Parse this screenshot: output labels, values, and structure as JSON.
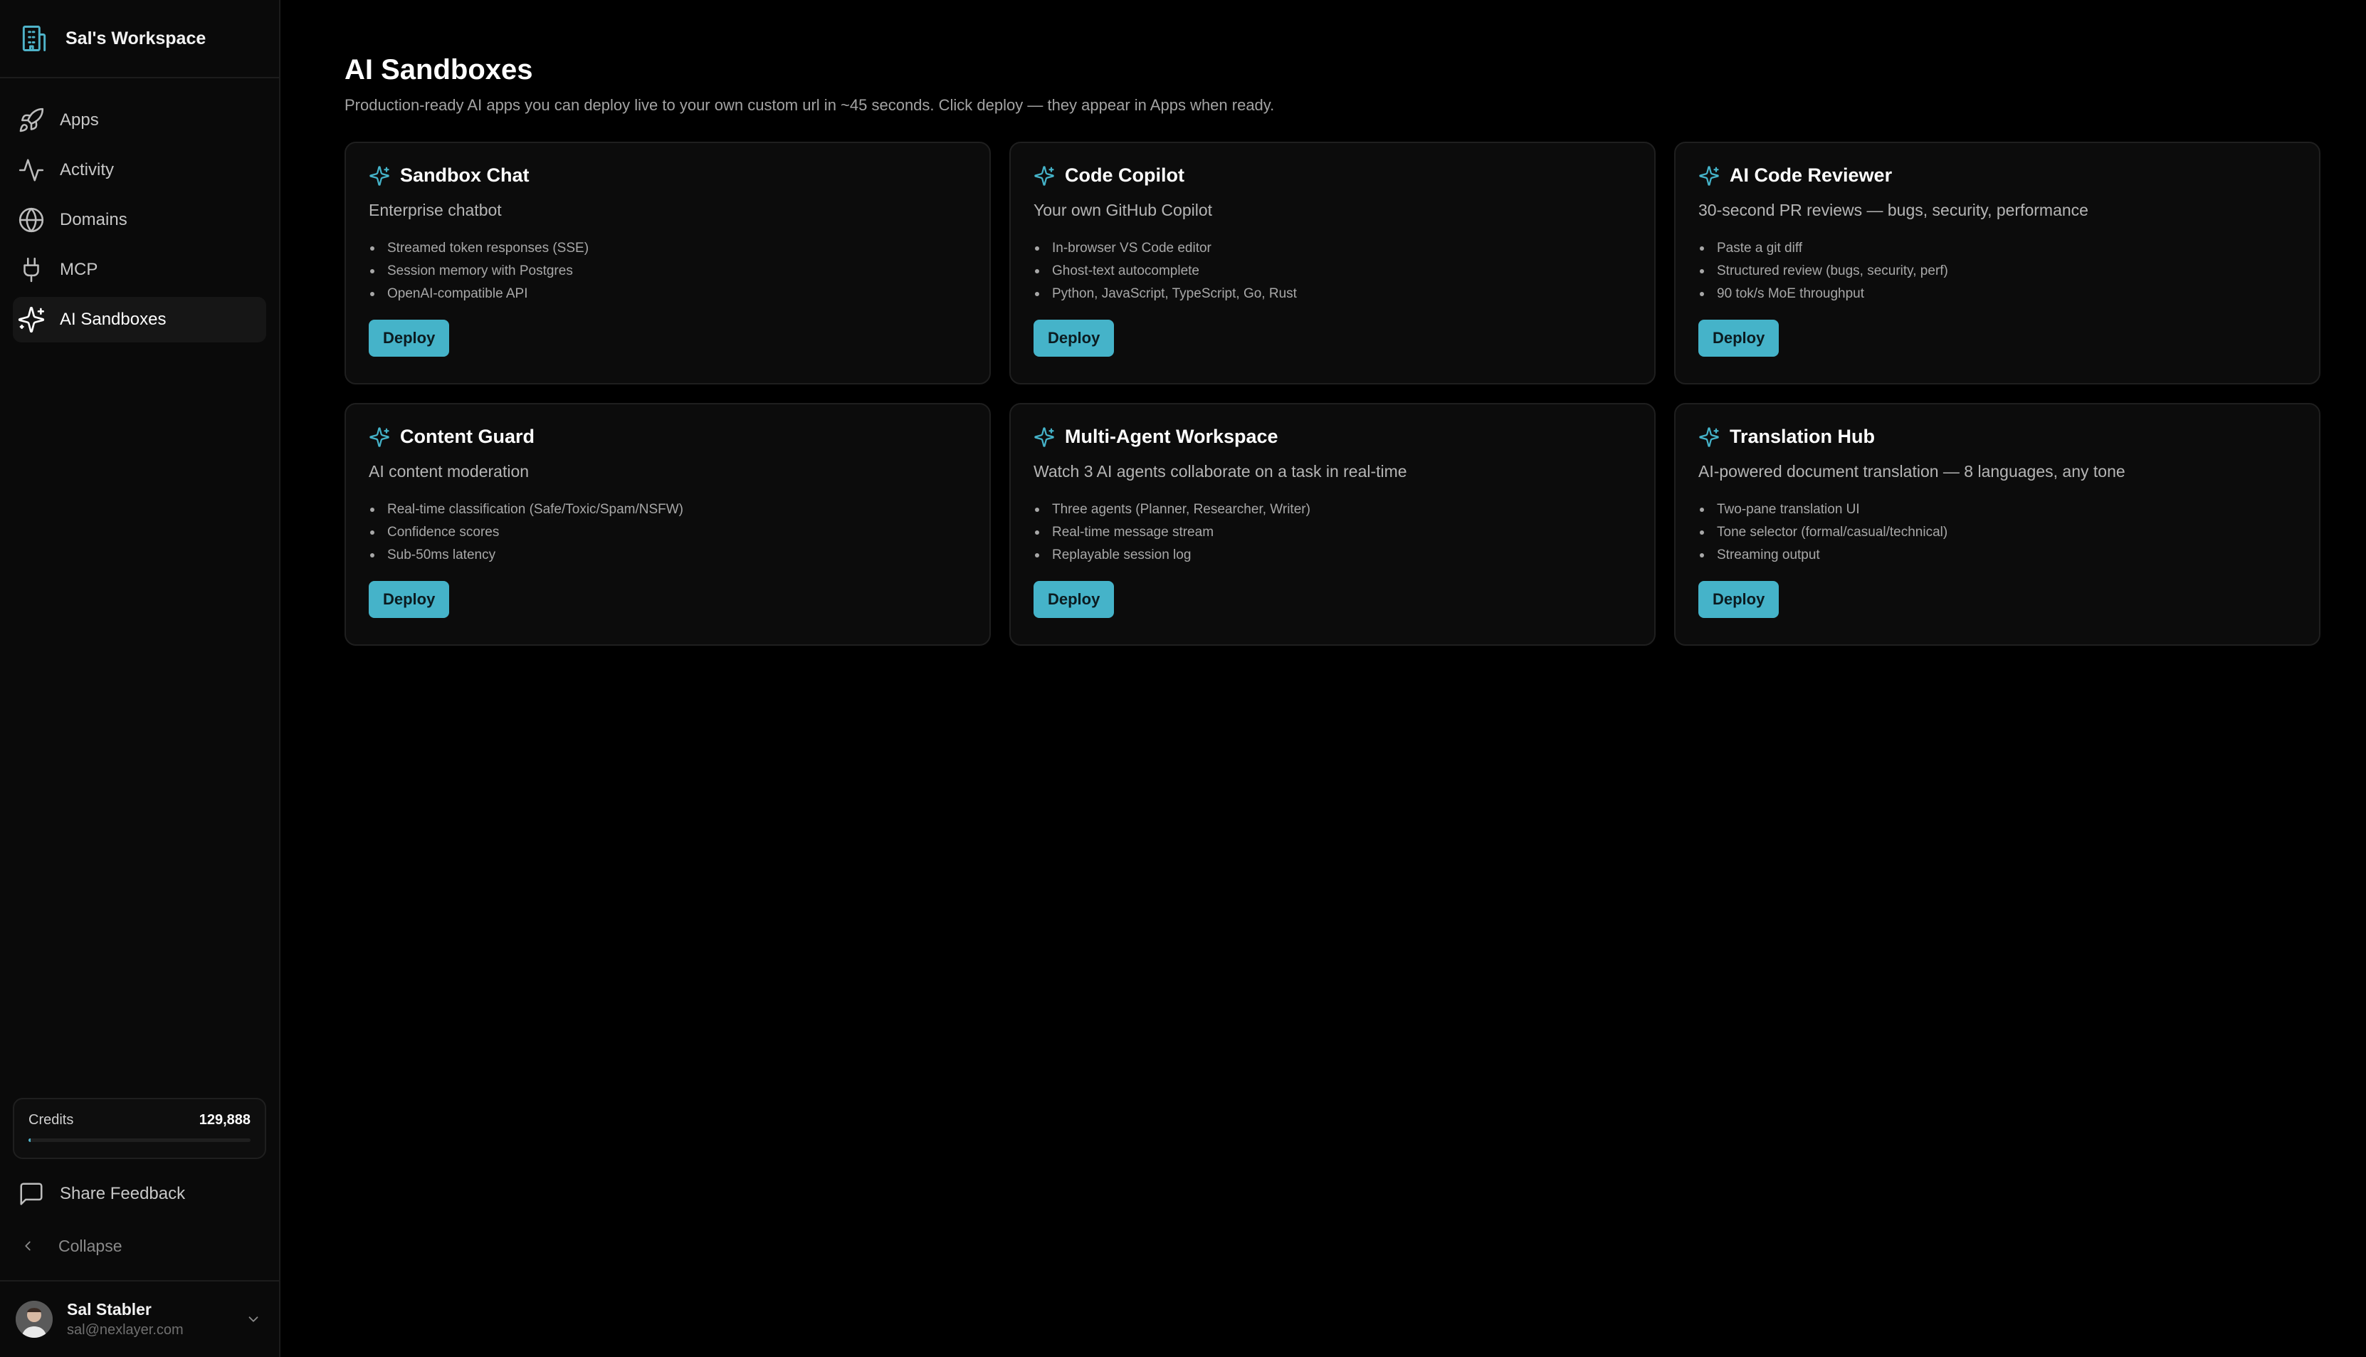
{
  "workspace": {
    "name": "Sal's Workspace"
  },
  "nav": {
    "items": [
      {
        "label": "Apps",
        "icon": "rocket-icon"
      },
      {
        "label": "Activity",
        "icon": "activity-icon"
      },
      {
        "label": "Domains",
        "icon": "globe-icon"
      },
      {
        "label": "MCP",
        "icon": "plug-icon"
      },
      {
        "label": "AI Sandboxes",
        "icon": "sparkles-icon",
        "active": true
      }
    ]
  },
  "credits": {
    "label": "Credits",
    "value": "129,888",
    "bar_fraction": 0.01
  },
  "feedback": {
    "label": "Share Feedback"
  },
  "collapse": {
    "label": "Collapse"
  },
  "user": {
    "name": "Sal Stabler",
    "email": "sal@nexlayer.com"
  },
  "page": {
    "title": "AI Sandboxes",
    "subtitle": "Production-ready AI apps you can deploy live to your own custom url in ~45 seconds. Click deploy — they appear in Apps when ready."
  },
  "cards": [
    {
      "title": "Sandbox Chat",
      "subtitle": "Enterprise chatbot",
      "features": [
        "Streamed token responses (SSE)",
        "Session memory with Postgres",
        "OpenAI-compatible API"
      ],
      "button": "Deploy"
    },
    {
      "title": "Code Copilot",
      "subtitle": "Your own GitHub Copilot",
      "features": [
        "In-browser VS Code editor",
        "Ghost-text autocomplete",
        "Python, JavaScript, TypeScript, Go, Rust"
      ],
      "button": "Deploy"
    },
    {
      "title": "AI Code Reviewer",
      "subtitle": "30-second PR reviews — bugs, security, performance",
      "features": [
        "Paste a git diff",
        "Structured review (bugs, security, perf)",
        "90 tok/s MoE throughput"
      ],
      "button": "Deploy"
    },
    {
      "title": "Content Guard",
      "subtitle": "AI content moderation",
      "features": [
        "Real-time classification (Safe/Toxic/Spam/NSFW)",
        "Confidence scores",
        "Sub-50ms latency"
      ],
      "button": "Deploy"
    },
    {
      "title": "Multi-Agent Workspace",
      "subtitle": "Watch 3 AI agents collaborate on a task in real-time",
      "features": [
        "Three agents (Planner, Researcher, Writer)",
        "Real-time message stream",
        "Replayable session log"
      ],
      "button": "Deploy"
    },
    {
      "title": "Translation Hub",
      "subtitle": "AI-powered document translation — 8 languages, any tone",
      "features": [
        "Two-pane translation UI",
        "Tone selector (formal/casual/technical)",
        "Streaming output"
      ],
      "button": "Deploy"
    }
  ],
  "colors": {
    "accent": "#45b3c9",
    "background": "#000000",
    "sidebar": "#0a0a0a",
    "card": "#0c0c0c"
  }
}
